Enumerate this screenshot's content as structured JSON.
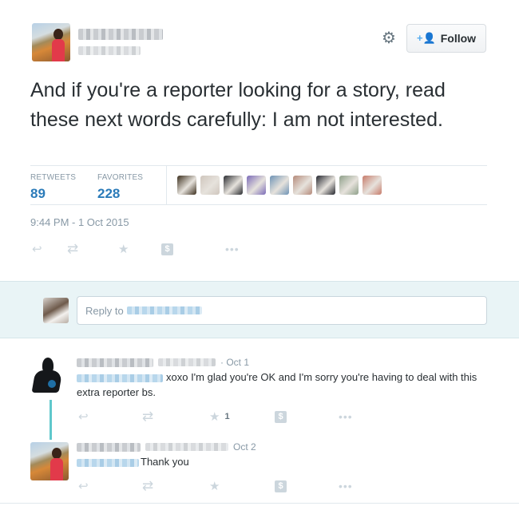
{
  "tweet": {
    "text": "And if you're a reporter looking for a story, read these next words carefully: I am not interested.",
    "follow_label": "Follow",
    "stats": {
      "retweets_label": "RETWEETS",
      "retweets_value": "89",
      "favorites_label": "FAVORITES",
      "favorites_value": "228"
    },
    "timestamp": "9:44 PM - 1 Oct 2015"
  },
  "favoriters_colors": [
    "#3c2f1e",
    "#cfc6bd",
    "#2a2c31",
    "#7b6bb8",
    "#6e93b5",
    "#b58a7a",
    "#24262e",
    "#8fa08a",
    "#c77b6a"
  ],
  "reply_box": {
    "placeholder_prefix": "Reply to"
  },
  "replies": [
    {
      "date": "· Oct 1",
      "text": "xoxo I'm glad you're OK and I'm sorry you're having to deal with this extra reporter bs.",
      "favorite_count": "1"
    },
    {
      "date": "Oct 2",
      "text": "Thank you",
      "favorite_count": ""
    }
  ],
  "icons": {
    "reply": "reply-arrow-icon",
    "retweet": "retweet-icon",
    "favorite": "star-icon",
    "buffer": "dollar-icon",
    "more": "more-dots-icon",
    "settings": "gear-icon",
    "follow": "add-user-icon"
  },
  "colors": {
    "link_blue": "#2b7bb9",
    "accent": "#55acee",
    "thread_line": "#5fc8cc",
    "reply_bg": "#e9f4f6"
  }
}
